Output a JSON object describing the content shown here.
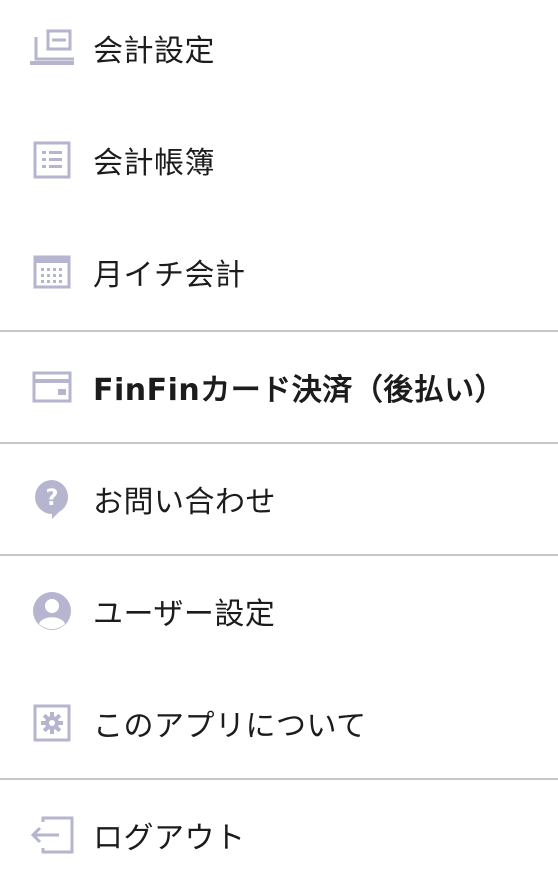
{
  "menu": {
    "icon_color": "#b6b5cf",
    "items": [
      {
        "label": "会計設定",
        "icon": "accounting-settings-icon"
      },
      {
        "label": "会計帳簿",
        "icon": "ledger-list-icon"
      },
      {
        "label": "月イチ会計",
        "icon": "calendar-icon"
      },
      {
        "label": "FinFinカード決済（後払い）",
        "icon": "card-icon"
      },
      {
        "label": "お問い合わせ",
        "icon": "question-bubble-icon"
      },
      {
        "label": "ユーザー設定",
        "icon": "user-icon"
      },
      {
        "label": "このアプリについて",
        "icon": "app-gear-icon"
      },
      {
        "label": "ログアウト",
        "icon": "logout-icon"
      }
    ]
  }
}
